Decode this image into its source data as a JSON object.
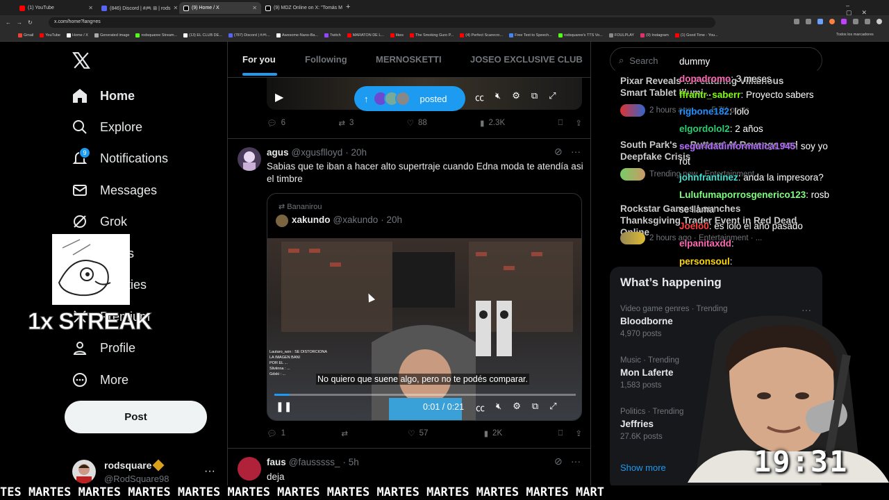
{
  "browser": {
    "tabs": [
      {
        "title": "(1) YouTube",
        "color": "#ff0000"
      },
      {
        "title": "(846) Discord | #🎮 ⊞ | rods",
        "color": "#5865f2"
      },
      {
        "title": "(9) Home / X",
        "color": "#ffffff"
      },
      {
        "title": "(9) MDZ Online on X: \"Tomás M",
        "color": "#ffffff"
      }
    ],
    "url": "x.com/home?lang=es",
    "bookmarks": [
      {
        "label": "Gmail",
        "color": "#ea4335"
      },
      {
        "label": "YouTube",
        "color": "#ff0000"
      },
      {
        "label": "Home / X",
        "color": "#ffffff"
      },
      {
        "label": "Generated image",
        "color": "#aaaaaa"
      },
      {
        "label": "rodsquaree Stream...",
        "color": "#53fc18"
      },
      {
        "label": "(13) EL CLUB DE...",
        "color": "#ffffff"
      },
      {
        "label": "(787) Discord | #🎮...",
        "color": "#5865f2"
      },
      {
        "label": "Awesome-Nano-Ba...",
        "color": "#ffffff"
      },
      {
        "label": "Twitch",
        "color": "#9146ff"
      },
      {
        "label": "MARATON DE L...",
        "color": "#ff0000"
      },
      {
        "label": "likes",
        "color": "#ff0000"
      },
      {
        "label": "The Smoking Guro P...",
        "color": "#ff0000"
      },
      {
        "label": "(4) Perfect Scarecro...",
        "color": "#ff0000"
      },
      {
        "label": "Free Text to Speech...",
        "color": "#4285f4"
      },
      {
        "label": "rodsquaree's TTS Vo...",
        "color": "#53fc18"
      },
      {
        "label": "FOULPLAY",
        "color": "#888888"
      },
      {
        "label": "(9) Instagram",
        "color": "#e1306c"
      },
      {
        "label": "(1) Good Time - You...",
        "color": "#ff0000"
      }
    ],
    "bookmarks_all": "Todos los marcadores"
  },
  "nav": {
    "items": [
      {
        "label": "Home",
        "icon": "home-icon"
      },
      {
        "label": "Explore",
        "icon": "search-icon"
      },
      {
        "label": "Notifications",
        "icon": "bell-icon"
      },
      {
        "label": "Messages",
        "icon": "mail-icon"
      },
      {
        "label": "Grok",
        "icon": "grok-icon"
      },
      {
        "label": "marks",
        "icon": "bookmark-icon"
      },
      {
        "label": "munities",
        "icon": "communities-icon"
      },
      {
        "label": "Premium",
        "icon": "x-icon"
      },
      {
        "label": "Profile",
        "icon": "profile-icon"
      },
      {
        "label": "More",
        "icon": "more-icon"
      }
    ],
    "notif_badge": "9",
    "post": "Post",
    "account_name": "rodsquare",
    "account_handle": "@RodSquare98"
  },
  "overlay": {
    "streak": "1x STREAK",
    "clock": "19:31",
    "ticker": "TES MARTES MARTES MARTES MARTES MARTES MARTES MARTES MARTES MARTES MARTES MARTES MART"
  },
  "feed": {
    "tabs": [
      "For you",
      "Following",
      "MERNOSKETTI",
      "JOSEO EXCLUSIVE CLUB"
    ],
    "posted_pill": "posted",
    "top_actions": {
      "replies": "6",
      "reposts": "3",
      "likes": "88",
      "views": "2.3K"
    },
    "post1": {
      "name": "agus",
      "handle": "@xgusflloyd",
      "time": "· 20h",
      "text": "Sabias que te iban a hacer alto supertraje cuando Edna moda te atendía asi el timbre",
      "quote_repost_by": "Bananirou",
      "quote_name": "xakundo",
      "quote_handle": "@xakundo",
      "quote_time": "· 20h",
      "subtitle": "No quiero que suene algo, pero no te podés comparar.",
      "video_time": "0:01 / 0:21",
      "actions": {
        "replies": "1",
        "reposts": "",
        "likes": "57",
        "views": "2K"
      }
    },
    "post2": {
      "name": "faus",
      "handle": "@fausssss_",
      "time": "· 5h",
      "text": "deja"
    }
  },
  "right": {
    "search_placeholder": "Search",
    "news": [
      {
        "title": "Pixar Reveals ... Featuring Villainous Smart Tablet Illumi...",
        "meta": "2 hours ago ..."
      },
      {
        "title": "South Park's ... Butters' AI Revenge and Deepfake Crisis",
        "meta": "Trending now · Entertainment · ..."
      },
      {
        "title": "Rockstar Games Launches Thanksgiving Trader Event in Red Dead Online",
        "meta": "2 hours ago · Entertainment · ..."
      }
    ],
    "news_counts": [
      "5.7K posts",
      "... posts",
      "... posts"
    ],
    "happening_title": "What’s happening",
    "trends": [
      {
        "meta": "Video game genres · Trending",
        "name": "Bloodborne",
        "count": "4,970 posts"
      },
      {
        "meta": "Music · Trending",
        "name": "Mon Laferte",
        "count": "1,583 posts"
      },
      {
        "meta": "Politics · Trending",
        "name": "Jeffries",
        "count": "27.6K posts"
      }
    ],
    "show_more": "Show more"
  },
  "chat": [
    {
      "user": "",
      "msg": "dummy",
      "color": "#ffffff"
    },
    {
      "user": "dopadromo",
      "msg": ": 3 meses",
      "color": "#ff69b4"
    },
    {
      "user": "ffrantr_saberr",
      "msg": ": Proyecto sabers",
      "color": "#7fff00"
    },
    {
      "user": "rigbone182",
      "msg": ": lolo",
      "color": "#1e90ff"
    },
    {
      "user": "elgordolol2",
      "msg": ": 2 años",
      "color": "#2ecc71"
    },
    {
      "user": "seguridadinformatica1945",
      "msg": ": soy yo",
      "color": "#b36bff"
    },
    {
      "user": "",
      "msg": "rot",
      "color": "#ffffff"
    },
    {
      "user": "johnfrantinez",
      "msg": ": anda la impresora?",
      "color": "#40e0d0"
    },
    {
      "user": "Lulufumaporrosgenerico123",
      "msg": ": rosb",
      "color": "#7fff7f"
    },
    {
      "user": "",
      "msg": "se llama",
      "color": "#ffffff"
    },
    {
      "user": "Joelo0",
      "msg": ": es lolo el año pasado",
      "color": "#ff4040"
    },
    {
      "user": "elpanitaxdd",
      "msg": ":",
      "color": "#ff69b4"
    },
    {
      "user": "personsoul",
      "msg": ":",
      "color": "#ffd700"
    }
  ]
}
